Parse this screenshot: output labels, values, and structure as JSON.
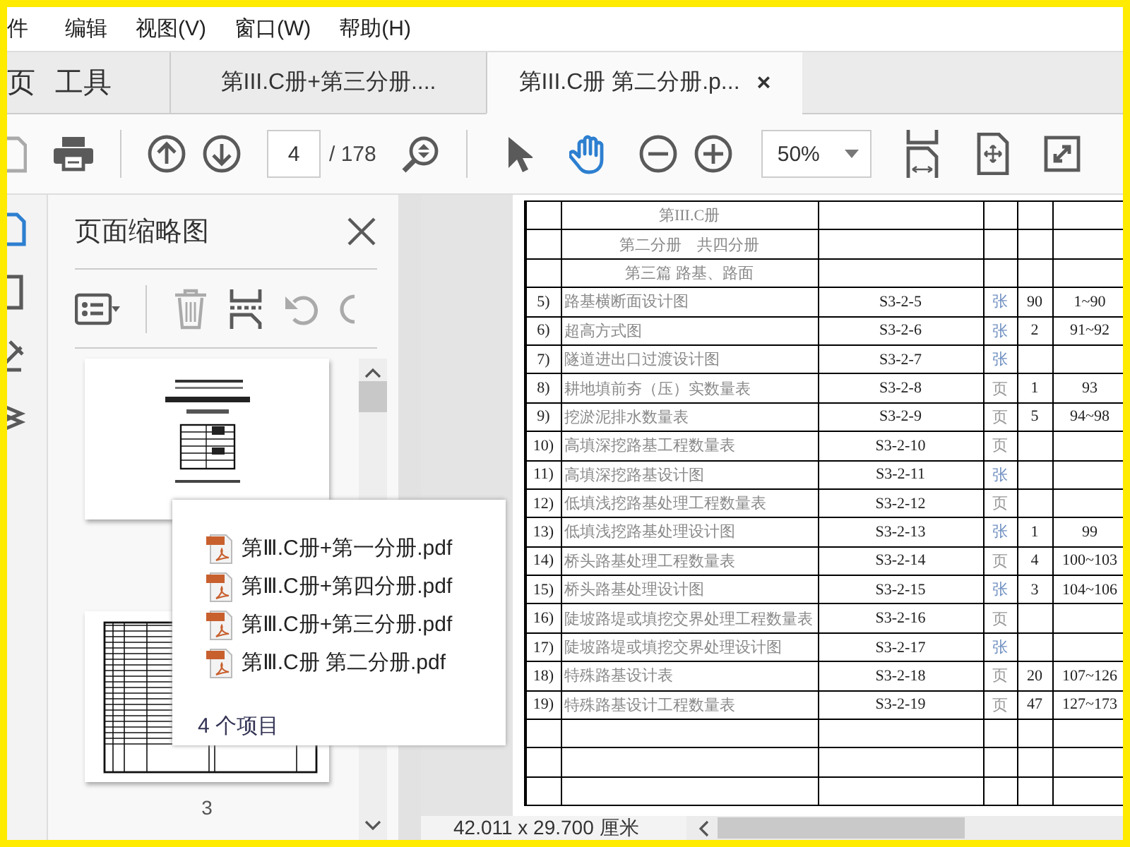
{
  "menu": [
    "件",
    "编辑",
    "视图(V)",
    "窗口(W)",
    "帮助(H)"
  ],
  "tabs": [
    {
      "label": "页",
      "kind": "home",
      "selected": false
    },
    {
      "label": "工具",
      "kind": "home",
      "selected": false
    },
    {
      "label": "第III.C册+第三分册....",
      "kind": "document",
      "selected": false
    },
    {
      "label": "第III.C册 第二分册.p...",
      "kind": "document",
      "selected": true,
      "close": "×"
    }
  ],
  "toolbar": {
    "page": "4",
    "page_total": "/ 178",
    "zoom": "50%",
    "tools": [
      {
        "kind": "select",
        "selected": false
      },
      {
        "kind": "hand",
        "selected": true
      }
    ]
  },
  "rail": [
    {
      "kind": "thumbnails",
      "selected": true
    },
    {
      "kind": "bookmarks",
      "selected": false
    },
    {
      "kind": "signature",
      "selected": false
    },
    {
      "kind": "layers",
      "selected": false
    }
  ],
  "side_panel": {
    "title": "页面缩略图",
    "thumbnails": [
      {
        "kind": "cover"
      },
      {
        "kind": "table",
        "page_label": "3"
      }
    ]
  },
  "popup": {
    "items": [
      "第Ⅲ.C册+第一分册.pdf",
      "第Ⅲ.C册+第四分册.pdf",
      "第Ⅲ.C册+第三分册.pdf",
      "第Ⅲ.C册 第二分册.pdf"
    ],
    "count": "4 个项目"
  },
  "document": {
    "header_rows": [
      "第III.C册",
      "第二分册　共四分册",
      "第三篇 路基、路面"
    ],
    "rows": [
      {
        "no": "5)",
        "name": "路基横断面设计图",
        "code": "S3-2-5",
        "unit": "张",
        "color": "#6f8fc0",
        "count": "90",
        "range": "1~90"
      },
      {
        "no": "6)",
        "name": "超高方式图",
        "code": "S3-2-6",
        "unit": "张",
        "color": "#6f8fc0",
        "count": "2",
        "range": "91~92"
      },
      {
        "no": "7)",
        "name": "隧道进出口过渡设计图",
        "code": "S3-2-7",
        "unit": "张",
        "color": "#6f8fc0"
      },
      {
        "no": "8)",
        "name": "耕地填前夯（压）实数量表",
        "code": "S3-2-8",
        "unit": "页",
        "color": "#999999",
        "count": "1",
        "range": "93"
      },
      {
        "no": "9)",
        "name": "挖淤泥排水数量表",
        "code": "S3-2-9",
        "unit": "页",
        "color": "#999999",
        "count": "5",
        "range": "94~98"
      },
      {
        "no": "10)",
        "name": "高填深挖路基工程数量表",
        "code": "S3-2-10",
        "unit": "页",
        "color": "#999999"
      },
      {
        "no": "11)",
        "name": "高填深挖路基设计图",
        "code": "S3-2-11",
        "unit": "张",
        "color": "#6f8fc0"
      },
      {
        "no": "12)",
        "name": "低填浅挖路基处理工程数量表",
        "code": "S3-2-12",
        "unit": "页",
        "color": "#999999"
      },
      {
        "no": "13)",
        "name": "低填浅挖路基处理设计图",
        "code": "S3-2-13",
        "unit": "张",
        "color": "#6f8fc0",
        "count": "1",
        "range": "99"
      },
      {
        "no": "14)",
        "name": "桥头路基处理工程数量表",
        "code": "S3-2-14",
        "unit": "页",
        "color": "#999999",
        "count": "4",
        "range": "100~103"
      },
      {
        "no": "15)",
        "name": "桥头路基处理设计图",
        "code": "S3-2-15",
        "unit": "张",
        "color": "#6f8fc0",
        "count": "3",
        "range": "104~106"
      },
      {
        "no": "16)",
        "name": "陡坡路堤或填挖交界处理工程数量表",
        "code": "S3-2-16",
        "unit": "页",
        "color": "#999999"
      },
      {
        "no": "17)",
        "name": "陡坡路堤或填挖交界处理设计图",
        "code": "S3-2-17",
        "unit": "张",
        "color": "#6f8fc0"
      },
      {
        "no": "18)",
        "name": "特殊路基设计表",
        "code": "S3-2-18",
        "unit": "页",
        "color": "#999999",
        "count": "20",
        "range": "107~126"
      },
      {
        "no": "19)",
        "name": "特殊路基设计工程数量表",
        "code": "S3-2-19",
        "unit": "页",
        "color": "#999999",
        "count": "47",
        "range": "127~173"
      }
    ]
  },
  "status_bar": {
    "size": "42.011 x 29.700 厘米"
  }
}
